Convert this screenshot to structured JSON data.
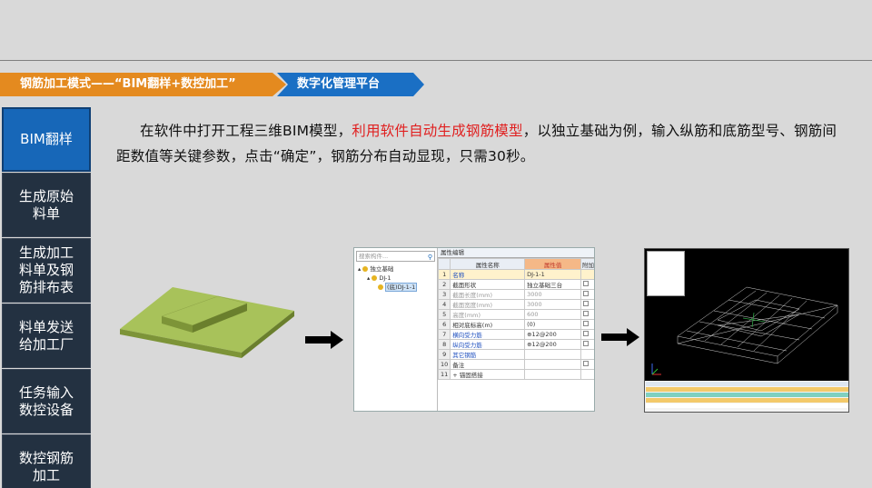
{
  "breadcrumb": {
    "mode": "钢筋加工模式——“BIM翻样+数控加工”",
    "platform": "数字化管理平台"
  },
  "sidebar": {
    "items": [
      {
        "label": "BIM翻样",
        "active": true
      },
      {
        "label": "生成原始料单",
        "active": false
      },
      {
        "label": "生成加工料单及钢筋排布表",
        "active": false
      },
      {
        "label": "料单发送给加工厂",
        "active": false
      },
      {
        "label": "任务输入数控设备",
        "active": false
      },
      {
        "label": "数控钢筋加工",
        "active": false
      }
    ]
  },
  "description": {
    "part1": "在软件中打开工程三维BIM模型，",
    "highlight": "利用软件自动生成钢筋模型",
    "part2": "，以独立基础为例，输入纵筋和底筋型号、钢筋间距数值等关键参数，点击“确定”，钢筋分布自动显现，只需30秒。"
  },
  "dialog": {
    "search_placeholder": "搜索构件...",
    "tree": [
      {
        "label": "独立基础",
        "level": 0
      },
      {
        "label": "DJ-1",
        "level": 1
      },
      {
        "label": "(底)DJ-1-1",
        "level": 2,
        "selected": true
      }
    ],
    "tab": "属性编辑",
    "columns": [
      "属性名称",
      "属性值",
      "附加"
    ],
    "rows": [
      {
        "n": "1",
        "name": "名称",
        "value": "DJ-1-1",
        "style": "blue",
        "hl": true,
        "cb": false
      },
      {
        "n": "2",
        "name": "截面形状",
        "value": "独立基础三台",
        "style": "",
        "hl": false,
        "cb": true
      },
      {
        "n": "3",
        "name": "截面长度(mm)",
        "value": "3000",
        "style": "grey",
        "hl": false,
        "cb": true
      },
      {
        "n": "4",
        "name": "截面宽度(mm)",
        "value": "3000",
        "style": "grey",
        "hl": false,
        "cb": true
      },
      {
        "n": "5",
        "name": "高度(mm)",
        "value": "600",
        "style": "grey",
        "hl": false,
        "cb": true
      },
      {
        "n": "6",
        "name": "相对底标高(m)",
        "value": "(0)",
        "style": "",
        "hl": false,
        "cb": true
      },
      {
        "n": "7",
        "name": "横向受力筋",
        "value": "⊕12@200",
        "style": "blue",
        "hl": false,
        "cb": true
      },
      {
        "n": "8",
        "name": "纵向受力筋",
        "value": "⊕12@200",
        "style": "blue",
        "hl": false,
        "cb": true
      },
      {
        "n": "9",
        "name": "其它钢筋",
        "value": "",
        "style": "blue",
        "hl": false,
        "cb": false
      },
      {
        "n": "10",
        "name": "备注",
        "value": "",
        "style": "",
        "hl": false,
        "cb": true
      },
      {
        "n": "11",
        "name": "+ 锚固搭接",
        "value": "",
        "style": "",
        "hl": false,
        "cb": false
      }
    ]
  }
}
